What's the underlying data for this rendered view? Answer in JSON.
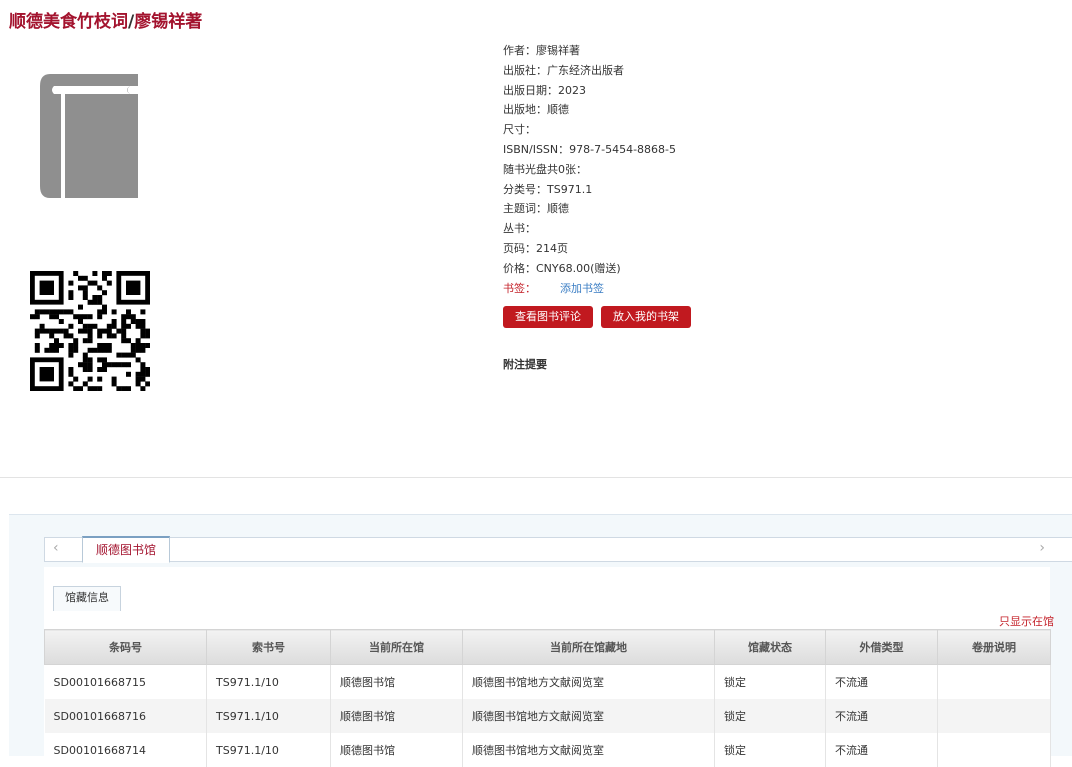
{
  "page": {
    "title_name": "顺德美食竹枝词",
    "title_sep": "/",
    "title_author": "廖锡祥著"
  },
  "icons": {
    "cover": "book-icon",
    "qr": "qr-code"
  },
  "meta": [
    "作者：廖锡祥著",
    "出版社：广东经济出版者",
    "出版日期：2023",
    "出版地：顺德",
    "尺寸：",
    "ISBN/ISSN：978-7-5454-8868-5",
    "随书光盘共0张：",
    "分类号：TS971.1",
    "主题词：顺德",
    "丛书：",
    "页码：214页",
    "价格：CNY68.00(赠送)"
  ],
  "bookmark": {
    "label": "书签：",
    "link": "添加书签"
  },
  "buttons": {
    "review": "查看图书评论",
    "shelf": "放入我的书架"
  },
  "notes_heading": "附注提要",
  "tabs": {
    "left_arrow": "‹",
    "right_arrow": "›",
    "library": "顺德图书馆",
    "holdings": "馆藏信息",
    "avail_only": "只显示在馆"
  },
  "colors": {
    "brand": "#a3132e",
    "button": "#c1191f",
    "link": "#3b7ec4"
  },
  "table": {
    "headers": [
      "条码号",
      "索书号",
      "当前所在馆",
      "当前所在馆藏地",
      "馆藏状态",
      "外借类型",
      "卷册说明"
    ],
    "rows": [
      [
        "SD00101668715",
        "TS971.1/10",
        "顺德图书馆",
        "顺德图书馆地方文献阅览室",
        "锁定",
        "不流通",
        ""
      ],
      [
        "SD00101668716",
        "TS971.1/10",
        "顺德图书馆",
        "顺德图书馆地方文献阅览室",
        "锁定",
        "不流通",
        ""
      ],
      [
        "SD00101668714",
        "TS971.1/10",
        "顺德图书馆",
        "顺德图书馆地方文献阅览室",
        "锁定",
        "不流通",
        ""
      ]
    ]
  }
}
